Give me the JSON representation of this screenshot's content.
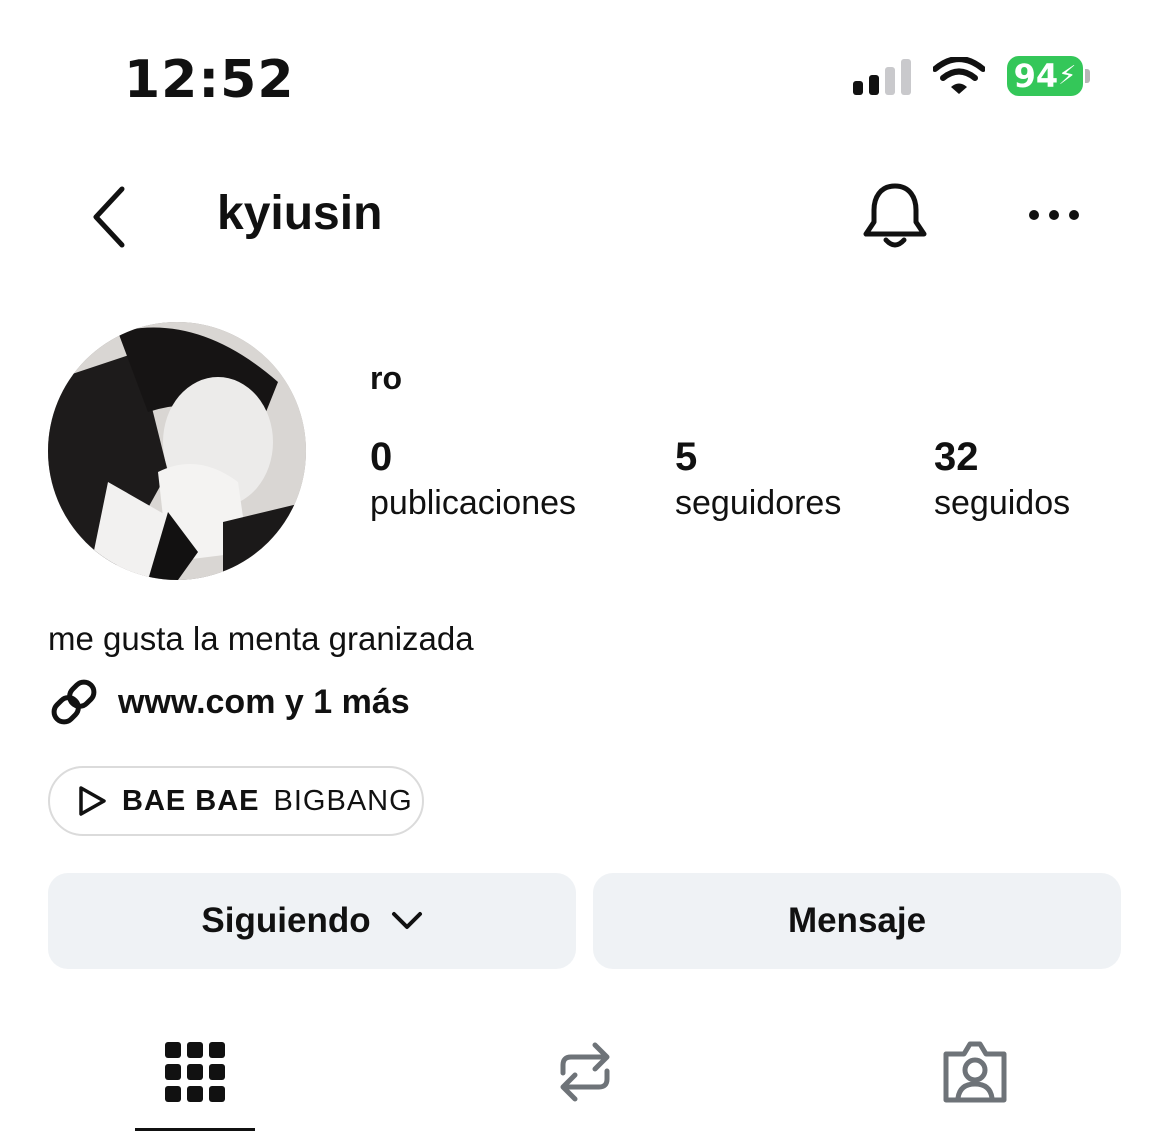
{
  "status_bar": {
    "time": "12:52",
    "battery": "94",
    "icons": [
      "cellular-signal-icon",
      "wifi-icon",
      "battery-charging-icon"
    ],
    "battery_color": "#34c759"
  },
  "header": {
    "username": "kyiusin",
    "icons": [
      "back-chevron-icon",
      "bell-icon",
      "more-icon"
    ]
  },
  "profile": {
    "display_name": "ro",
    "stats": {
      "posts": {
        "value": "0",
        "label": "publicaciones"
      },
      "followers": {
        "value": "5",
        "label": "seguidores"
      },
      "following": {
        "value": "32",
        "label": "seguidos"
      }
    },
    "bio": "me gusta la menta granizada",
    "link": "www.com y 1 más",
    "music": {
      "title": "BAE BAE",
      "artist": "BIGBANG"
    }
  },
  "actions": {
    "following_label": "Siguiendo",
    "message_label": "Mensaje"
  },
  "tabs": [
    {
      "name": "grid-icon",
      "selected": true
    },
    {
      "name": "reposts-icon",
      "selected": false
    },
    {
      "name": "tagged-icon",
      "selected": false
    }
  ],
  "colors": {
    "button_bg": "#eff2f5",
    "text": "#111111"
  }
}
